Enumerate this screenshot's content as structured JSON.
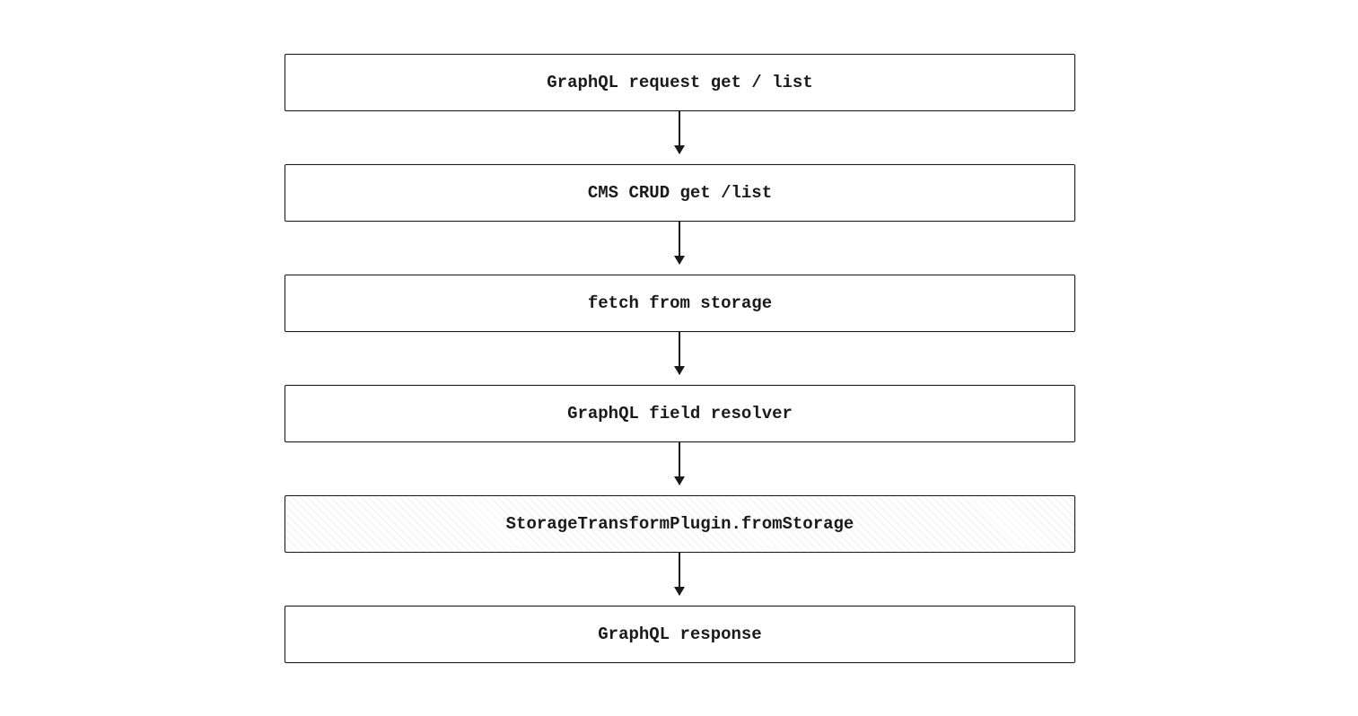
{
  "diagram": {
    "nodes": [
      {
        "id": "graphql-request",
        "label": "GraphQL request get / list",
        "highlighted": false
      },
      {
        "id": "cms-crud",
        "label": "CMS CRUD get /list",
        "highlighted": false
      },
      {
        "id": "fetch-storage",
        "label": "fetch from storage",
        "highlighted": false
      },
      {
        "id": "field-resolver",
        "label": "GraphQL field resolver",
        "highlighted": false
      },
      {
        "id": "from-storage",
        "label": "StorageTransformPlugin.fromStorage",
        "highlighted": true
      },
      {
        "id": "graphql-response",
        "label": "GraphQL response",
        "highlighted": false
      }
    ],
    "layout": {
      "node_tops": [
        60,
        183,
        306,
        429,
        552,
        675
      ],
      "arrow_tops": [
        123,
        246,
        369,
        492,
        615
      ],
      "arrow_height": 48
    }
  }
}
